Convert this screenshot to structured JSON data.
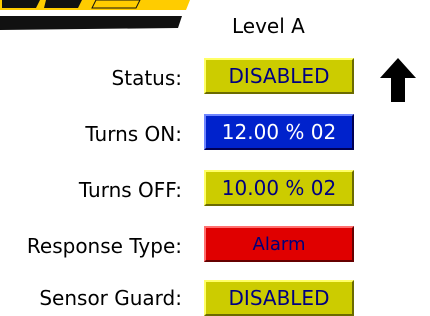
{
  "header": {
    "level_title": "Level A"
  },
  "rows": [
    {
      "label": "Status:",
      "value": "DISABLED",
      "color": "#cccc00"
    },
    {
      "label": "Turns ON:",
      "value": "12.00 % 02",
      "color": "#0022cc"
    },
    {
      "label": "Turns OFF:",
      "value": "10.00 % 02",
      "color": "#cccc00"
    },
    {
      "label": "Response Type:",
      "value": "Alarm",
      "color": "#e00000"
    },
    {
      "label": "Sensor Guard:",
      "value": "DISABLED",
      "color": "#cccc00"
    }
  ],
  "icons": {
    "logo": "brand-logo-icon",
    "arrow": "up-arrow-icon"
  }
}
